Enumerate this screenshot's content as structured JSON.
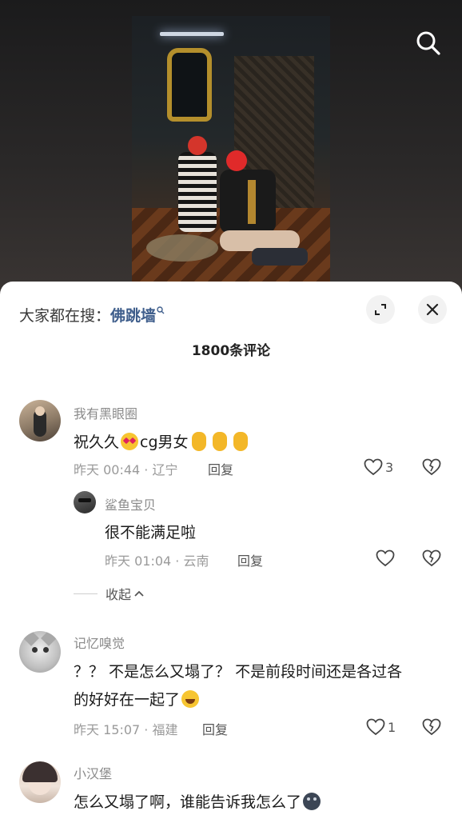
{
  "header": {
    "search_icon": "search-icon"
  },
  "sheet": {
    "hot_search_label": "大家都在搜：",
    "hot_search_keyword": "佛跳墙",
    "comment_count": "1800条评论",
    "expand_icon": "expand-icon",
    "close_icon": "close-icon"
  },
  "comments": [
    {
      "username": "我有黑眼圈",
      "text_a": "祝久久",
      "text_b": "cg男女",
      "meta": "昨天 00:44 · 辽宁",
      "reply_label": "回复",
      "like_count": "3"
    },
    {
      "username": "鲨鱼宝贝",
      "text": "很不能满足啦",
      "meta": "昨天 01:04 · 云南",
      "reply_label": "回复"
    },
    {
      "username": "记忆嗅觉",
      "text_line1": "？？ 不是怎么又塌了？ 不是前段时间还是各过各",
      "text_line2": "的好好在一起了",
      "meta": "昨天 15:07 · 福建",
      "reply_label": "回复",
      "like_count": "1"
    },
    {
      "username": "小汉堡",
      "text": "怎么又塌了啊，谁能告诉我怎么了"
    }
  ],
  "collapse_label": "收起"
}
